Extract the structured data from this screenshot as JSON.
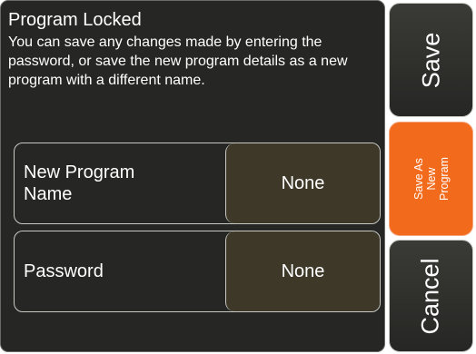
{
  "dialog": {
    "title": "Program Locked",
    "message": "You can save any changes made by entering the password, or save the new program details as a new program with a different name."
  },
  "fields": {
    "new_program_name": {
      "label": "New Program\nName",
      "value": "None"
    },
    "password": {
      "label": "Password",
      "value": "None"
    }
  },
  "buttons": {
    "save": "Save",
    "save_as_new_program": "Save As\nNew\nProgram",
    "cancel": "Cancel"
  },
  "colors": {
    "panel_bg": "#262624",
    "value_bg": "#3e3828",
    "accent": "#f26a1b",
    "border": "#c9c9c4",
    "text": "#ffffff"
  }
}
